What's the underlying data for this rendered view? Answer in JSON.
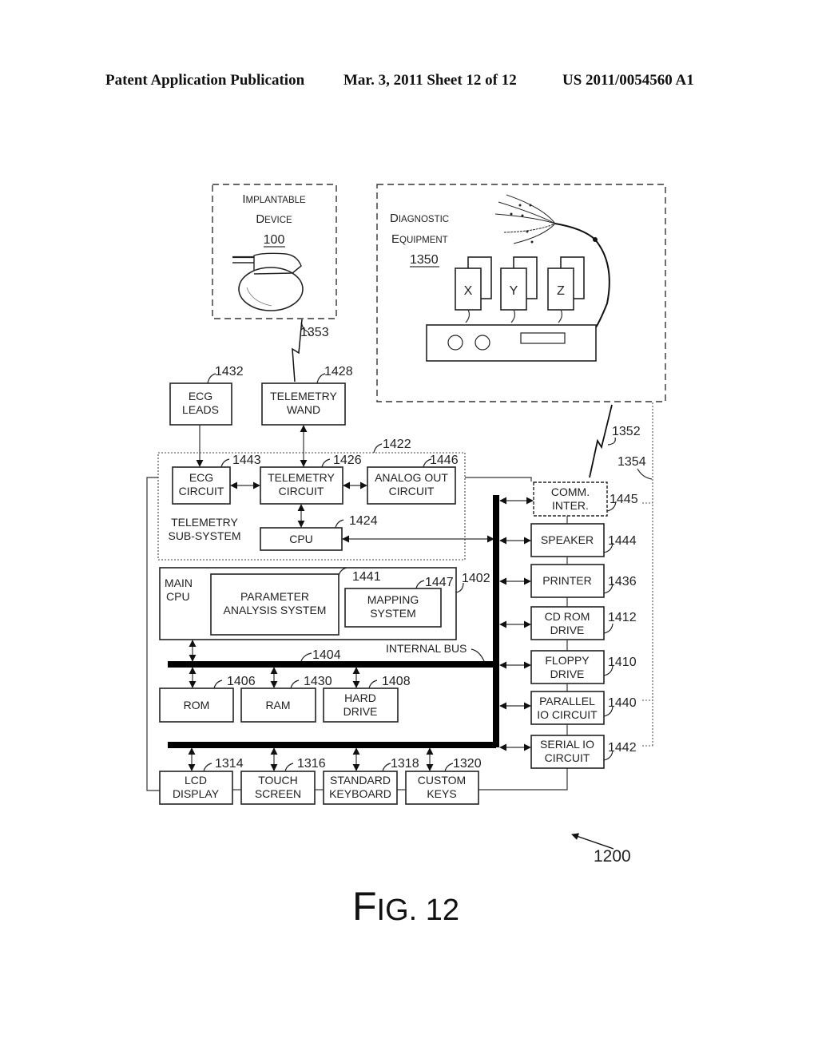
{
  "header": {
    "left": "Patent Application Publication",
    "middle": "Mar. 3, 2011   Sheet 12 of 12",
    "right": "US 2011/0054560 A1"
  },
  "figure": {
    "label_prefix": "F",
    "label_rest": "IG. 12",
    "ref": "1200"
  },
  "implantable": {
    "line1_cap": "I",
    "line1_rest": "MPLANTABLE",
    "line2_cap": "D",
    "line2_rest": "EVICE",
    "ref": "100",
    "link_ref": "1353"
  },
  "diagnostic": {
    "line1_cap": "D",
    "line1_rest": "IAGNOSTIC",
    "line2_cap": "E",
    "line2_rest": "QUIPMENT",
    "ref": "1350",
    "channels": [
      "X",
      "Y",
      "Z"
    ],
    "wireless_ref": "1352",
    "wired_ref": "1354"
  },
  "blocks": {
    "ecg_leads": {
      "line1": "ECG",
      "line2": "LEADS",
      "ref": "1432"
    },
    "telemetry_wand": {
      "line1": "TELEMETRY",
      "line2": "WAND",
      "ref": "1428"
    },
    "telemetry_subsystem": {
      "line1": "TELEMETRY",
      "line2": "SUB-SYSTEM",
      "ref": "1422"
    },
    "ecg_circuit": {
      "line1": "ECG",
      "line2": "CIRCUIT",
      "ref": "1443"
    },
    "telemetry_circuit": {
      "line1": "TELEMETRY",
      "line2": "CIRCUIT",
      "ref": "1426"
    },
    "analog_out": {
      "line1": "ANALOG OUT",
      "line2": "CIRCUIT",
      "ref": "1446"
    },
    "cpu": {
      "label": "CPU",
      "ref": "1424"
    },
    "main_cpu": {
      "line1": "MAIN",
      "line2": "CPU",
      "ref": "1402"
    },
    "param_analysis": {
      "line1": "PARAMETER",
      "line2": "ANALYSIS SYSTEM",
      "ref": "1441"
    },
    "mapping": {
      "line1": "MAPPING",
      "line2": "SYSTEM",
      "ref": "1447"
    },
    "internal_bus": {
      "label": "INTERNAL BUS",
      "ref": "1404"
    },
    "rom": {
      "label": "ROM",
      "ref": "1406"
    },
    "ram": {
      "label": "RAM",
      "ref": "1430"
    },
    "hard_drive": {
      "line1": "HARD",
      "line2": "DRIVE",
      "ref": "1408"
    },
    "comm_inter": {
      "line1": "COMM.",
      "line2": "INTER.",
      "ref": "1445"
    },
    "speaker": {
      "label": "SPEAKER",
      "ref": "1444"
    },
    "printer": {
      "label": "PRINTER",
      "ref": "1436"
    },
    "cd_rom": {
      "line1": "CD ROM",
      "line2": "DRIVE",
      "ref": "1412"
    },
    "floppy": {
      "line1": "FLOPPY",
      "line2": "DRIVE",
      "ref": "1410"
    },
    "parallel_io": {
      "line1": "PARALLEL",
      "line2": "IO CIRCUIT",
      "ref": "1440"
    },
    "serial_io": {
      "line1": "SERIAL IO",
      "line2": "CIRCUIT",
      "ref": "1442"
    },
    "lcd": {
      "line1": "LCD",
      "line2": "DISPLAY",
      "ref": "1314"
    },
    "touch": {
      "line1": "TOUCH",
      "line2": "SCREEN",
      "ref": "1316"
    },
    "keyboard": {
      "line1": "STANDARD",
      "line2": "KEYBOARD",
      "ref": "1318"
    },
    "custom_keys": {
      "line1": "CUSTOM",
      "line2": "KEYS",
      "ref": "1320"
    }
  }
}
